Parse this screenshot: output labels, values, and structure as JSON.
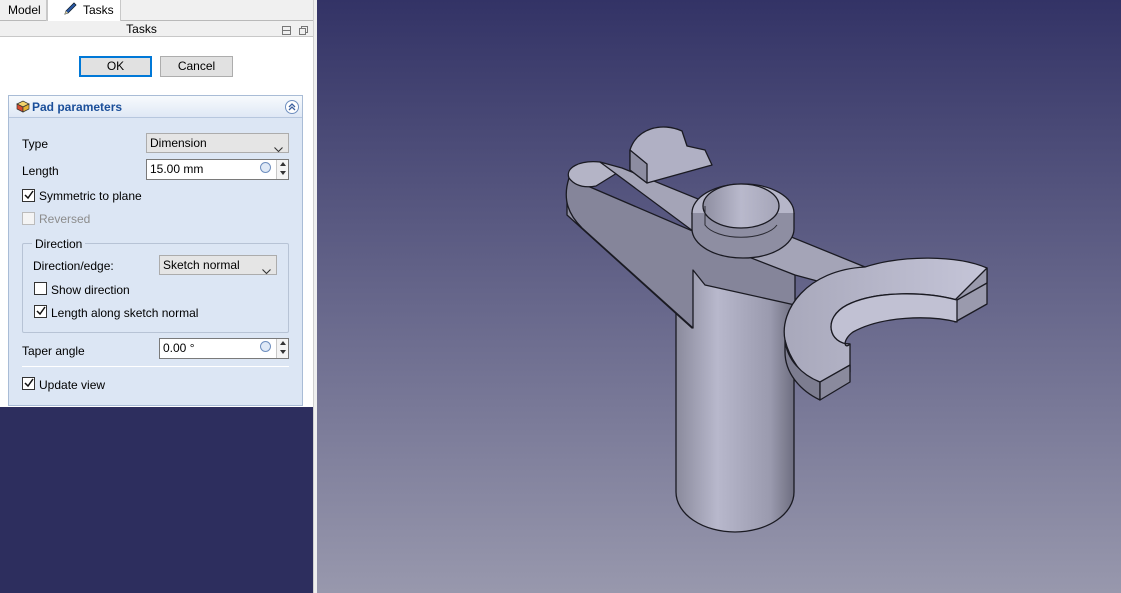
{
  "tabs": {
    "model": "Model",
    "tasks": "Tasks"
  },
  "tasks_panel": {
    "title": "Tasks"
  },
  "dialog_buttons": {
    "ok": "OK",
    "cancel": "Cancel"
  },
  "pad": {
    "title": "Pad parameters",
    "type_label": "Type",
    "type_value": "Dimension",
    "length_label": "Length",
    "length_value": "15.00 mm",
    "symmetric_label": "Symmetric to plane",
    "symmetric_checked": true,
    "reversed_label": "Reversed",
    "reversed_checked": false,
    "direction": {
      "group_label": "Direction",
      "edge_label": "Direction/edge:",
      "edge_value": "Sketch normal",
      "show_direction_label": "Show direction",
      "show_direction_checked": false,
      "along_normal_label": "Length along sketch normal",
      "along_normal_checked": true
    },
    "taper_label": "Taper angle",
    "taper_value": "0.00 °",
    "update_view_label": "Update view",
    "update_view_checked": true
  },
  "colors": {
    "viewport_top": "#333366",
    "viewport_bottom": "#9898ad",
    "part_face_light": "#c3c3d6",
    "part_face_mid": "#9f9fb2",
    "part_face_dark": "#7f7f8f"
  }
}
